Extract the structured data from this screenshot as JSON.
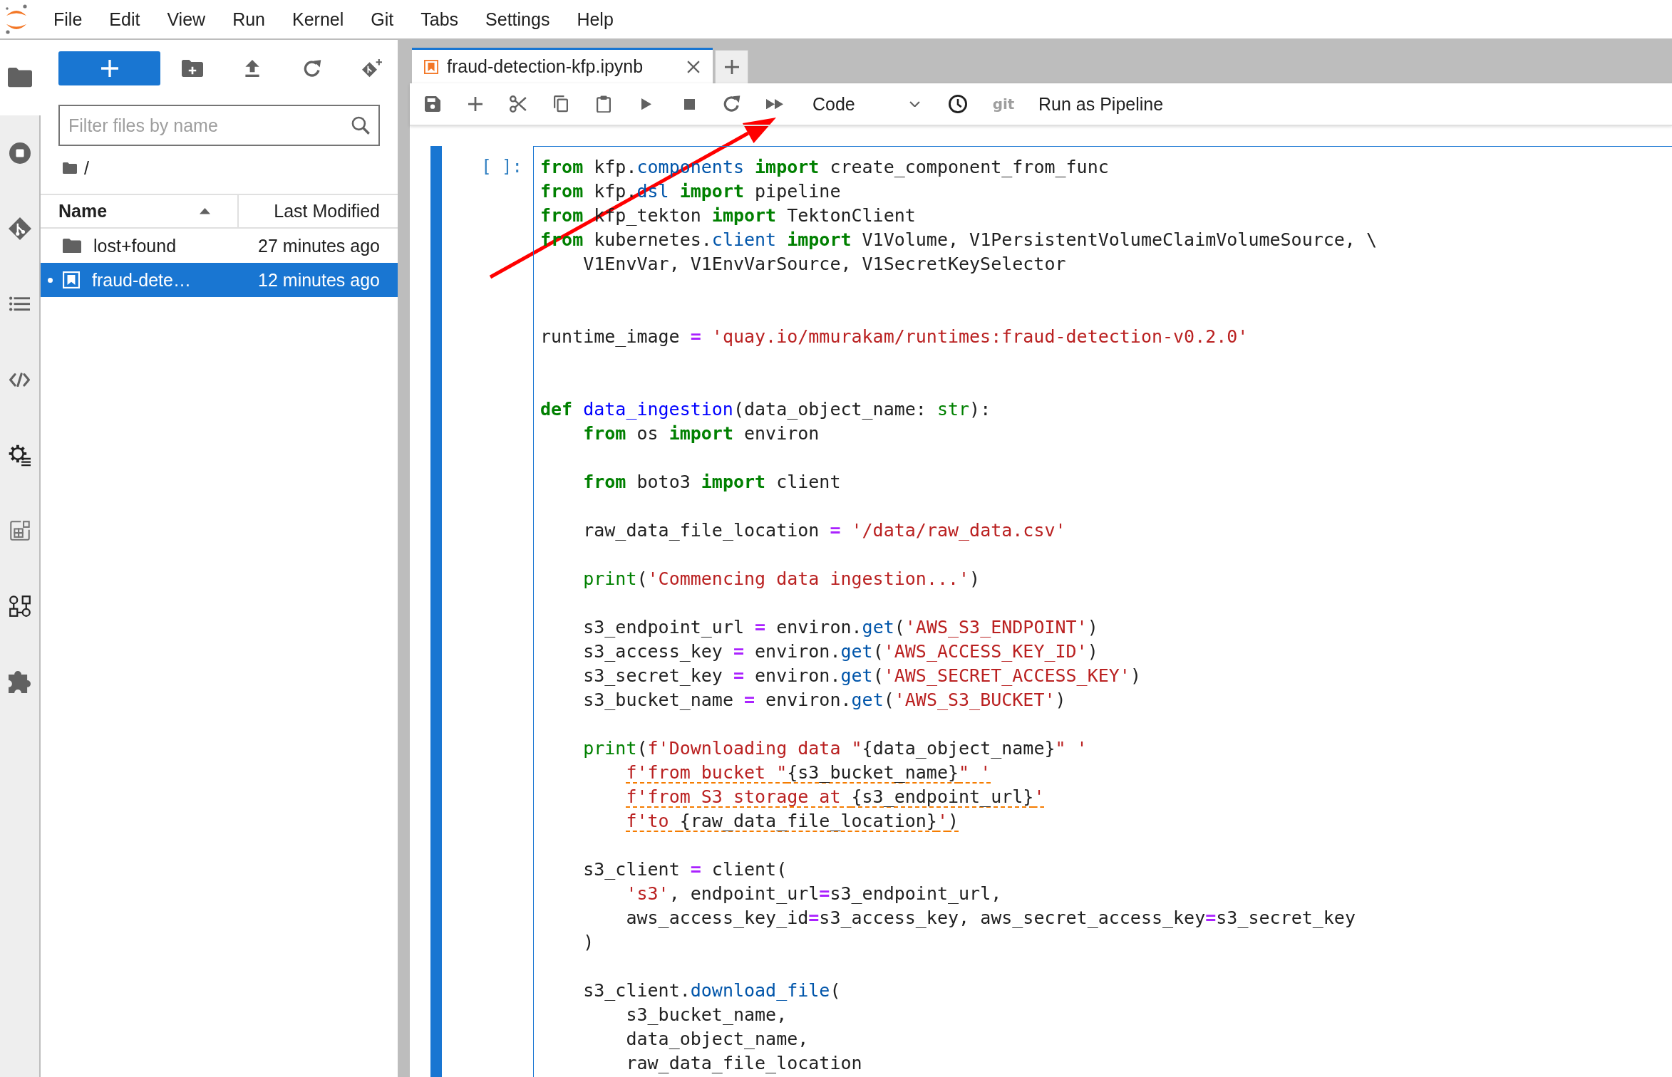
{
  "menu_bar": {
    "items": [
      "File",
      "Edit",
      "View",
      "Run",
      "Kernel",
      "Git",
      "Tabs",
      "Settings",
      "Help"
    ]
  },
  "activity_bar": {
    "items": [
      {
        "kind": "files",
        "selected": true
      },
      {
        "kind": "running",
        "selected": false
      },
      {
        "kind": "git",
        "selected": false
      },
      {
        "kind": "toc",
        "selected": false
      },
      {
        "kind": "snippets",
        "selected": false
      },
      {
        "kind": "runtimes",
        "selected": false
      },
      {
        "kind": "catalog",
        "selected": false
      },
      {
        "kind": "pipelines",
        "selected": false
      },
      {
        "kind": "extensions",
        "selected": false
      }
    ]
  },
  "file_browser": {
    "filter": {
      "placeholder": "Filter files by name"
    },
    "path": "/",
    "columns": [
      {
        "label": "Name",
        "sorted": true
      },
      {
        "label": "Last Modified",
        "sorted": false
      }
    ],
    "rows": [
      {
        "kind": "folder",
        "name": "lost+found",
        "modified": "27 minutes ago",
        "selected": false,
        "running": false
      },
      {
        "kind": "notebook",
        "name": "fraud-dete…",
        "modified": "12 minutes ago",
        "selected": true,
        "running": true
      }
    ]
  },
  "notebook": {
    "tabs": [
      {
        "title": "fraud-detection-kfp.ipynb",
        "selected": true
      }
    ],
    "toolbar": {
      "cell_type": "Code",
      "git_label": "git",
      "run_pipeline": "Run as Pipeline"
    },
    "cell": {
      "prompt": "[ ]:",
      "selected": true,
      "code": [
        {
          "kind": "line",
          "warning": false,
          "tokens": [
            {
              "kind": "keyword",
              "text": "from"
            },
            {
              "kind": "plain",
              "text": " kfp."
            },
            {
              "kind": "attribute",
              "text": "components"
            },
            {
              "kind": "keyword",
              "text": " import"
            },
            {
              "kind": "plain",
              "text": " create_component_from_func"
            }
          ]
        },
        {
          "kind": "line",
          "warning": false,
          "tokens": [
            {
              "kind": "keyword",
              "text": "from"
            },
            {
              "kind": "plain",
              "text": " kfp."
            },
            {
              "kind": "attribute",
              "text": "dsl"
            },
            {
              "kind": "keyword",
              "text": " import"
            },
            {
              "kind": "plain",
              "text": " pipeline"
            }
          ]
        },
        {
          "kind": "line",
          "warning": false,
          "tokens": [
            {
              "kind": "keyword",
              "text": "from"
            },
            {
              "kind": "plain",
              "text": " kfp_tekton "
            },
            {
              "kind": "keyword",
              "text": "import"
            },
            {
              "kind": "plain",
              "text": " TektonClient"
            }
          ]
        },
        {
          "kind": "line",
          "warning": false,
          "tokens": [
            {
              "kind": "keyword",
              "text": "from"
            },
            {
              "kind": "plain",
              "text": " kubernetes."
            },
            {
              "kind": "attribute",
              "text": "client"
            },
            {
              "kind": "keyword",
              "text": " import"
            },
            {
              "kind": "plain",
              "text": " V1Volume, V1PersistentVolumeClaimVolumeSource, \\"
            }
          ]
        },
        {
          "kind": "line",
          "warning": false,
          "tokens": [
            {
              "kind": "plain",
              "text": "    V1EnvVar, V1EnvVarSource, V1SecretKeySelector"
            }
          ]
        },
        {
          "kind": "section",
          "warning": false,
          "tokens": [
            {
              "kind": "plain",
              "text": "runtime_image "
            },
            {
              "kind": "operator",
              "text": "="
            },
            {
              "kind": "string",
              "text": " 'quay.io/mmurakam/runtimes:fraud-detection-v0.2.0'"
            }
          ]
        },
        {
          "kind": "section",
          "warning": false,
          "tokens": [
            {
              "kind": "keyword",
              "text": "def"
            },
            {
              "kind": "function",
              "text": " data_ingestion"
            },
            {
              "kind": "plain",
              "text": "(data_object_name: "
            },
            {
              "kind": "builtin",
              "text": "str"
            },
            {
              "kind": "plain",
              "text": "):"
            }
          ]
        },
        {
          "kind": "line",
          "warning": false,
          "tokens": [
            {
              "kind": "keyword",
              "text": "    from"
            },
            {
              "kind": "plain",
              "text": " os "
            },
            {
              "kind": "keyword",
              "text": "import"
            },
            {
              "kind": "plain",
              "text": " environ"
            }
          ]
        },
        {
          "kind": "paragraph",
          "warning": false,
          "tokens": [
            {
              "kind": "keyword",
              "text": "    from"
            },
            {
              "kind": "plain",
              "text": " boto3 "
            },
            {
              "kind": "keyword",
              "text": "import"
            },
            {
              "kind": "plain",
              "text": " client"
            }
          ]
        },
        {
          "kind": "paragraph",
          "warning": false,
          "tokens": [
            {
              "kind": "plain",
              "text": "    raw_data_file_location "
            },
            {
              "kind": "operator",
              "text": "="
            },
            {
              "kind": "string",
              "text": " '/data/raw_data.csv'"
            }
          ]
        },
        {
          "kind": "paragraph",
          "warning": false,
          "tokens": [
            {
              "kind": "builtin",
              "text": "    print"
            },
            {
              "kind": "plain",
              "text": "("
            },
            {
              "kind": "string",
              "text": "'Commencing data ingestion...'"
            },
            {
              "kind": "plain",
              "text": ")"
            }
          ]
        },
        {
          "kind": "paragraph",
          "warning": false,
          "tokens": [
            {
              "kind": "plain",
              "text": "    s3_endpoint_url "
            },
            {
              "kind": "operator",
              "text": "="
            },
            {
              "kind": "plain",
              "text": " environ."
            },
            {
              "kind": "attribute",
              "text": "get"
            },
            {
              "kind": "plain",
              "text": "("
            },
            {
              "kind": "string",
              "text": "'AWS_S3_ENDPOINT'"
            },
            {
              "kind": "plain",
              "text": ")"
            }
          ]
        },
        {
          "kind": "line",
          "warning": false,
          "tokens": [
            {
              "kind": "plain",
              "text": "    s3_access_key "
            },
            {
              "kind": "operator",
              "text": "="
            },
            {
              "kind": "plain",
              "text": " environ."
            },
            {
              "kind": "attribute",
              "text": "get"
            },
            {
              "kind": "plain",
              "text": "("
            },
            {
              "kind": "string",
              "text": "'AWS_ACCESS_KEY_ID'"
            },
            {
              "kind": "plain",
              "text": ")"
            }
          ]
        },
        {
          "kind": "line",
          "warning": false,
          "tokens": [
            {
              "kind": "plain",
              "text": "    s3_secret_key "
            },
            {
              "kind": "operator",
              "text": "="
            },
            {
              "kind": "plain",
              "text": " environ."
            },
            {
              "kind": "attribute",
              "text": "get"
            },
            {
              "kind": "plain",
              "text": "("
            },
            {
              "kind": "string",
              "text": "'AWS_SECRET_ACCESS_KEY'"
            },
            {
              "kind": "plain",
              "text": ")"
            }
          ]
        },
        {
          "kind": "line",
          "warning": false,
          "tokens": [
            {
              "kind": "plain",
              "text": "    s3_bucket_name "
            },
            {
              "kind": "operator",
              "text": "="
            },
            {
              "kind": "plain",
              "text": " environ."
            },
            {
              "kind": "attribute",
              "text": "get"
            },
            {
              "kind": "plain",
              "text": "("
            },
            {
              "kind": "string",
              "text": "'AWS_S3_BUCKET'"
            },
            {
              "kind": "plain",
              "text": ")"
            }
          ]
        },
        {
          "kind": "paragraph",
          "warning": false,
          "tokens": [
            {
              "kind": "builtin",
              "text": "    print"
            },
            {
              "kind": "plain",
              "text": "("
            },
            {
              "kind": "string",
              "text": "f'Downloading data \""
            },
            {
              "kind": "plain",
              "text": "{data_object_name}"
            },
            {
              "kind": "string",
              "text": "\" '"
            }
          ]
        },
        {
          "kind": "line",
          "warning": true,
          "tokens": [
            {
              "kind": "string",
              "text": "        f'from bucket \""
            },
            {
              "kind": "plain",
              "text": "{s3_bucket_name}"
            },
            {
              "kind": "string",
              "text": "\" '"
            }
          ]
        },
        {
          "kind": "line",
          "warning": true,
          "tokens": [
            {
              "kind": "string",
              "text": "        f'from S3 storage at "
            },
            {
              "kind": "plain",
              "text": "{s3_endpoint_url}"
            },
            {
              "kind": "string",
              "text": "'"
            }
          ]
        },
        {
          "kind": "line",
          "warning": true,
          "tokens": [
            {
              "kind": "string",
              "text": "        f'to "
            },
            {
              "kind": "plain",
              "text": "{raw_data_file_location}"
            },
            {
              "kind": "string",
              "text": "'"
            },
            {
              "kind": "plain",
              "text": ")"
            }
          ]
        },
        {
          "kind": "paragraph",
          "warning": false,
          "tokens": [
            {
              "kind": "plain",
              "text": "    s3_client "
            },
            {
              "kind": "operator",
              "text": "="
            },
            {
              "kind": "plain",
              "text": " client("
            }
          ]
        },
        {
          "kind": "line",
          "warning": false,
          "tokens": [
            {
              "kind": "string",
              "text": "        's3'"
            },
            {
              "kind": "plain",
              "text": ", endpoint_url"
            },
            {
              "kind": "operator",
              "text": "="
            },
            {
              "kind": "plain",
              "text": "s3_endpoint_url,"
            }
          ]
        },
        {
          "kind": "line",
          "warning": false,
          "tokens": [
            {
              "kind": "plain",
              "text": "        aws_access_key_id"
            },
            {
              "kind": "operator",
              "text": "="
            },
            {
              "kind": "plain",
              "text": "s3_access_key, aws_secret_access_key"
            },
            {
              "kind": "operator",
              "text": "="
            },
            {
              "kind": "plain",
              "text": "s3_secret_key"
            }
          ]
        },
        {
          "kind": "line",
          "warning": false,
          "tokens": [
            {
              "kind": "plain",
              "text": "    )"
            }
          ]
        },
        {
          "kind": "paragraph",
          "warning": false,
          "tokens": [
            {
              "kind": "plain",
              "text": "    s3_client."
            },
            {
              "kind": "attribute",
              "text": "download_file"
            },
            {
              "kind": "plain",
              "text": "("
            }
          ]
        },
        {
          "kind": "line",
          "warning": false,
          "tokens": [
            {
              "kind": "plain",
              "text": "        s3_bucket_name,"
            }
          ]
        },
        {
          "kind": "line",
          "warning": false,
          "tokens": [
            {
              "kind": "plain",
              "text": "        data_object_name,"
            }
          ]
        },
        {
          "kind": "line",
          "warning": false,
          "tokens": [
            {
              "kind": "plain",
              "text": "        raw_data_file_location"
            }
          ]
        }
      ]
    }
  }
}
